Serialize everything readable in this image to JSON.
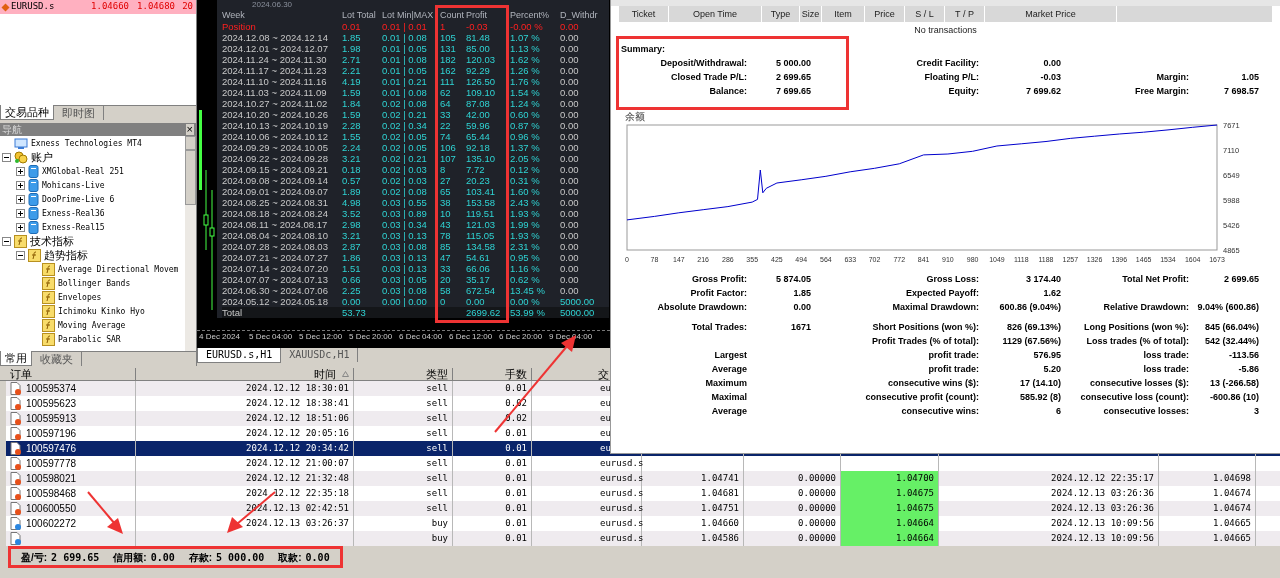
{
  "market_watch": {
    "rows": [
      {
        "symbol": "EURUSD.s",
        "bid": "1.04660",
        "ask": "1.04680",
        "spread": "20"
      }
    ]
  },
  "market_tabs": [
    {
      "label": "交易品种",
      "selected": true
    },
    {
      "label": "即时图",
      "selected": false
    }
  ],
  "navigator": {
    "title": "导航",
    "close": "×",
    "tree": [
      {
        "label": "Exness Technologies MT4",
        "kind": "server"
      },
      {
        "label": "账户",
        "kind": "accounts",
        "expanded": true,
        "children": [
          {
            "label": "XMGlobal-Real 251",
            "kind": "account",
            "expanded": false
          },
          {
            "label": "Mohicans-Live",
            "kind": "account",
            "expanded": false
          },
          {
            "label": "DooPrime-Live 6",
            "kind": "account",
            "expanded": false
          },
          {
            "label": "Exness-Real36",
            "kind": "account",
            "expanded": false
          },
          {
            "label": "Exness-Real15",
            "kind": "account",
            "expanded": false
          }
        ]
      },
      {
        "label": "技术指标",
        "kind": "indicator",
        "expanded": true,
        "children": [
          {
            "label": "趋势指标",
            "kind": "indicator",
            "expanded": true,
            "children": [
              {
                "label": "Average Directional Movem",
                "kind": "indicator"
              },
              {
                "label": "Bollinger Bands",
                "kind": "indicator"
              },
              {
                "label": "Envelopes",
                "kind": "indicator"
              },
              {
                "label": "Ichimoku Kinko Hyo",
                "kind": "indicator"
              },
              {
                "label": "Moving Average",
                "kind": "indicator"
              },
              {
                "label": "Parabolic SAR",
                "kind": "indicator"
              }
            ]
          }
        ]
      }
    ]
  },
  "navigator_tabs": [
    {
      "label": "常用",
      "selected": true
    },
    {
      "label": "收藏夹",
      "selected": false
    }
  ],
  "weekly_report": {
    "caption": "2024.06.30",
    "columns": [
      "Week",
      "Lot Total",
      "Lot Min|MAX",
      "Count",
      "Profit",
      "Percent%",
      "D_Withdr"
    ],
    "rows": [
      {
        "kind": "position",
        "week": "Position",
        "lot_total": "0.01",
        "lot_range": "0.01 | 0.01",
        "count": "1",
        "profit": "-0.03",
        "percent": "-0.00 %",
        "withdrawal": "0.00"
      },
      {
        "kind": "week",
        "week": "2024.12.08 ~ 2024.12.14",
        "lot_total": "1.85",
        "lot_range": "0.01 | 0.08",
        "count": "105",
        "profit": "81.48",
        "percent": "1.07 %",
        "withdrawal": "0.00"
      },
      {
        "kind": "week",
        "week": "2024.12.01 ~ 2024.12.07",
        "lot_total": "1.98",
        "lot_range": "0.01 | 0.05",
        "count": "131",
        "profit": "85.00",
        "percent": "1.13 %",
        "withdrawal": "0.00"
      },
      {
        "kind": "week",
        "week": "2024.11.24 ~ 2024.11.30",
        "lot_total": "2.71",
        "lot_range": "0.01 | 0.08",
        "count": "182",
        "profit": "120.03",
        "percent": "1.62 %",
        "withdrawal": "0.00"
      },
      {
        "kind": "week",
        "week": "2024.11.17 ~ 2024.11.23",
        "lot_total": "2.21",
        "lot_range": "0.01 | 0.05",
        "count": "162",
        "profit": "92.29",
        "percent": "1.26 %",
        "withdrawal": "0.00"
      },
      {
        "kind": "week",
        "week": "2024.11.10 ~ 2024.11.16",
        "lot_total": "4.19",
        "lot_range": "0.01 | 0.21",
        "count": "111",
        "profit": "126.50",
        "percent": "1.76 %",
        "withdrawal": "0.00"
      },
      {
        "kind": "week",
        "week": "2024.11.03 ~ 2024.11.09",
        "lot_total": "1.59",
        "lot_range": "0.01 | 0.08",
        "count": "62",
        "profit": "109.10",
        "percent": "1.54 %",
        "withdrawal": "0.00"
      },
      {
        "kind": "week",
        "week": "2024.10.27 ~ 2024.11.02",
        "lot_total": "1.84",
        "lot_range": "0.02 | 0.08",
        "count": "64",
        "profit": "87.08",
        "percent": "1.24 %",
        "withdrawal": "0.00"
      },
      {
        "kind": "week",
        "week": "2024.10.20 ~ 2024.10.26",
        "lot_total": "1.59",
        "lot_range": "0.02 | 0.21",
        "count": "33",
        "profit": "42.00",
        "percent": "0.60 %",
        "withdrawal": "0.00"
      },
      {
        "kind": "week",
        "week": "2024.10.13 ~ 2024.10.19",
        "lot_total": "2.28",
        "lot_range": "0.02 | 0.34",
        "count": "22",
        "profit": "59.96",
        "percent": "0.87 %",
        "withdrawal": "0.00"
      },
      {
        "kind": "week",
        "week": "2024.10.06 ~ 2024.10.12",
        "lot_total": "1.55",
        "lot_range": "0.02 | 0.05",
        "count": "74",
        "profit": "65.44",
        "percent": "0.96 %",
        "withdrawal": "0.00"
      },
      {
        "kind": "week",
        "week": "2024.09.29 ~ 2024.10.05",
        "lot_total": "2.24",
        "lot_range": "0.02 | 0.05",
        "count": "106",
        "profit": "92.18",
        "percent": "1.37 %",
        "withdrawal": "0.00"
      },
      {
        "kind": "week",
        "week": "2024.09.22 ~ 2024.09.28",
        "lot_total": "3.21",
        "lot_range": "0.02 | 0.21",
        "count": "107",
        "profit": "135.10",
        "percent": "2.05 %",
        "withdrawal": "0.00"
      },
      {
        "kind": "week",
        "week": "2024.09.15 ~ 2024.09.21",
        "lot_total": "0.18",
        "lot_range": "0.02 | 0.03",
        "count": "8",
        "profit": "7.72",
        "percent": "0.12 %",
        "withdrawal": "0.00"
      },
      {
        "kind": "week",
        "week": "2024.09.08 ~ 2024.09.14",
        "lot_total": "0.57",
        "lot_range": "0.02 | 0.03",
        "count": "27",
        "profit": "20.23",
        "percent": "0.31 %",
        "withdrawal": "0.00"
      },
      {
        "kind": "week",
        "week": "2024.09.01 ~ 2024.09.07",
        "lot_total": "1.89",
        "lot_range": "0.02 | 0.08",
        "count": "65",
        "profit": "103.41",
        "percent": "1.60 %",
        "withdrawal": "0.00"
      },
      {
        "kind": "week",
        "week": "2024.08.25 ~ 2024.08.31",
        "lot_total": "4.98",
        "lot_range": "0.03 | 0.55",
        "count": "38",
        "profit": "153.58",
        "percent": "2.43 %",
        "withdrawal": "0.00"
      },
      {
        "kind": "week",
        "week": "2024.08.18 ~ 2024.08.24",
        "lot_total": "3.52",
        "lot_range": "0.03 | 0.89",
        "count": "10",
        "profit": "119.51",
        "percent": "1.93 %",
        "withdrawal": "0.00"
      },
      {
        "kind": "week",
        "week": "2024.08.11 ~ 2024.08.17",
        "lot_total": "2.98",
        "lot_range": "0.03 | 0.34",
        "count": "43",
        "profit": "121.03",
        "percent": "1.99 %",
        "withdrawal": "0.00"
      },
      {
        "kind": "week",
        "week": "2024.08.04 ~ 2024.08.10",
        "lot_total": "3.21",
        "lot_range": "0.03 | 0.13",
        "count": "78",
        "profit": "115.05",
        "percent": "1.93 %",
        "withdrawal": "0.00"
      },
      {
        "kind": "week",
        "week": "2024.07.28 ~ 2024.08.03",
        "lot_total": "2.87",
        "lot_range": "0.03 | 0.08",
        "count": "85",
        "profit": "134.58",
        "percent": "2.31 %",
        "withdrawal": "0.00"
      },
      {
        "kind": "week",
        "week": "2024.07.21 ~ 2024.07.27",
        "lot_total": "1.86",
        "lot_range": "0.03 | 0.13",
        "count": "47",
        "profit": "54.61",
        "percent": "0.95 %",
        "withdrawal": "0.00"
      },
      {
        "kind": "week",
        "week": "2024.07.14 ~ 2024.07.20",
        "lot_total": "1.51",
        "lot_range": "0.03 | 0.13",
        "count": "33",
        "profit": "66.06",
        "percent": "1.16 %",
        "withdrawal": "0.00"
      },
      {
        "kind": "week",
        "week": "2024.07.07 ~ 2024.07.13",
        "lot_total": "0.66",
        "lot_range": "0.03 | 0.05",
        "count": "20",
        "profit": "35.17",
        "percent": "0.62 %",
        "withdrawal": "0.00"
      },
      {
        "kind": "week",
        "week": "2024.06.30 ~ 2024.07.06",
        "lot_total": "2.25",
        "lot_range": "0.03 | 0.08",
        "count": "58",
        "profit": "672.54",
        "percent": "13.45 %",
        "withdrawal": "0.00"
      },
      {
        "kind": "deposit",
        "week": "2024.05.12 ~ 2024.05.18",
        "lot_total": "0.00",
        "lot_range": "0.00 | 0.00",
        "count": "0",
        "profit": "0.00",
        "percent": "0.00 %",
        "withdrawal": "5000.00"
      },
      {
        "kind": "total",
        "week": "Total",
        "lot_total": "53.73",
        "profit": "2699.62",
        "percent": "53.99 %",
        "withdrawal": "5000.00"
      }
    ]
  },
  "chart_axis": [
    "4 Dec 2024",
    "5 Dec 04:00",
    "5 Dec 12:00",
    "5 Dec 20:00",
    "6 Dec 04:00",
    "6 Dec 12:00",
    "6 Dec 20:00",
    "9 Dec 04:00"
  ],
  "chart_tabs": [
    {
      "label": "EURUSD.s,H1",
      "selected": true
    },
    {
      "label": "XAUUSDc,H1",
      "selected": false
    }
  ],
  "report": {
    "orders_columns": [
      "Ticket",
      "Open Time",
      "Type",
      "Size",
      "Item",
      "Price",
      "S / L",
      "T / P",
      "Market Price"
    ],
    "empty_message": "No transactions",
    "summary_title": "Summary:",
    "summary_rows": [
      {
        "label_1": "Deposit/Withdrawal:",
        "value_1": "5 000.00",
        "label_2": "Credit Facility:",
        "value_2": "0.00"
      },
      {
        "label_1": "Closed Trade P/L:",
        "value_1": "2 699.65",
        "label_2": "Floating P/L:",
        "value_2": "-0.03",
        "label_3": "Margin:",
        "value_3": "1.05"
      },
      {
        "label_1": "Balance:",
        "value_1": "7 699.65",
        "label_2": "Equity:",
        "value_2": "7 699.62",
        "label_3": "Free Margin:",
        "value_3": "7 698.57"
      }
    ],
    "chart": {
      "chart_data": {
        "type": "line",
        "title": "余额",
        "x": [
          0,
          78,
          147,
          216,
          286,
          355,
          370,
          378,
          385,
          395,
          425,
          494,
          564,
          633,
          702,
          772,
          841,
          910,
          980,
          1049,
          1118,
          1188,
          1257,
          1326,
          1396,
          1465,
          1534,
          1604,
          1673
        ],
        "series": [
          {
            "color": "#0000cc",
            "values": [
              5540,
              5620,
              5700,
              5770,
              5840,
              5940,
              6000,
              6660,
              6150,
              6250,
              6370,
              6440,
              6520,
              6620,
              6700,
              6800,
              7000,
              7020,
              7080,
              7200,
              7250,
              7300,
              7370,
              7420,
              7470,
              7510,
              7560,
              7620,
              7670
            ]
          }
        ],
        "xlim": [
          0,
          1673
        ],
        "ylim": [
          4865,
          7671
        ],
        "xticks": [
          0,
          78,
          147,
          216,
          286,
          355,
          425,
          494,
          564,
          633,
          702,
          772,
          841,
          910,
          980,
          1049,
          1118,
          1188,
          1257,
          1326,
          1396,
          1465,
          1534,
          1604,
          1673
        ],
        "yticks": [
          4865,
          5426,
          5988,
          6549,
          7110,
          7671
        ]
      }
    },
    "stats": [
      [
        {
          "label_1": "Gross Profit:",
          "value_1": "5 874.05",
          "label_2": "Gross Loss:",
          "value_2": "3 174.40",
          "label_3": "Total Net Profit:",
          "value_3": "2 699.65"
        },
        {
          "label_1": "Profit Factor:",
          "value_1": "1.85",
          "label_2": "Expected Payoff:",
          "value_2": "1.62"
        },
        {
          "label_1": "Absolute Drawdown:",
          "value_1": "0.00",
          "label_2": "Maximal Drawdown:",
          "value_2": "600.86 (9.04%)",
          "label_3": "Relative Drawdown:",
          "value_3": "9.04% (600.86)"
        }
      ],
      [
        {
          "label_1": "Total Trades:",
          "value_1": "1671",
          "label_2": "Short Positions (won %):",
          "value_2": "826 (69.13%)",
          "label_3": "Long Positions (won %):",
          "value_3": "845 (66.04%)"
        },
        {
          "label_2": "Profit Trades (% of total):",
          "value_2": "1129 (67.56%)",
          "label_3": "Loss trades (% of total):",
          "value_3": "542 (32.44%)"
        },
        {
          "label_1": "Largest",
          "label_2": "profit trade:",
          "value_2": "576.95",
          "label_3": "loss trade:",
          "value_3": "-113.56"
        },
        {
          "label_1": "Average",
          "label_2": "profit trade:",
          "value_2": "5.20",
          "label_3": "loss trade:",
          "value_3": "-5.86"
        },
        {
          "label_1": "Maximum",
          "label_2": "consecutive wins ($):",
          "value_2": "17 (14.10)",
          "label_3": "consecutive losses ($):",
          "value_3": "13 (-266.58)"
        },
        {
          "label_1": "Maximal",
          "label_2": "consecutive profit (count):",
          "value_2": "585.92 (8)",
          "label_3": "consecutive loss (count):",
          "value_3": "-600.86 (10)"
        },
        {
          "label_1": "Average",
          "label_2": "consecutive wins:",
          "value_2": "6",
          "label_3": "consecutive losses:",
          "value_3": "3"
        }
      ]
    ]
  },
  "terminal": {
    "columns": [
      "订单",
      "时间",
      "类型",
      "手数",
      "交"
    ],
    "rows": [
      {
        "kind": "sell",
        "selected": false,
        "order": "100595374",
        "time": "2024.12.12 18:30:01",
        "type": "sell",
        "lots": "0.01",
        "symbol": "eu"
      },
      {
        "kind": "sell",
        "selected": false,
        "order": "100595623",
        "time": "2024.12.12 18:38:41",
        "type": "sell",
        "lots": "0.02",
        "symbol": "eu"
      },
      {
        "kind": "sell",
        "selected": false,
        "order": "100595913",
        "time": "2024.12.12 18:51:06",
        "type": "sell",
        "lots": "0.02",
        "symbol": "eu"
      },
      {
        "kind": "sell",
        "selected": false,
        "order": "100597196",
        "time": "2024.12.12 20:05:16",
        "type": "sell",
        "lots": "0.01",
        "symbol": "eu"
      },
      {
        "kind": "sell",
        "selected": true,
        "order": "100597476",
        "time": "2024.12.12 20:34:42",
        "type": "sell",
        "lots": "0.01",
        "symbol": "eu"
      },
      {
        "kind": "sell",
        "selected": false,
        "order": "100597778",
        "time": "2024.12.12 21:00:07",
        "type": "sell",
        "lots": "0.01",
        "symbol": "eurusd.s"
      },
      {
        "kind": "sell",
        "selected": false,
        "order": "100598021",
        "time": "2024.12.12 21:32:48",
        "type": "sell",
        "lots": "0.01",
        "symbol": "eurusd.s",
        "open_price": "1.04741",
        "sl": "0.00000",
        "tp": "1.04700",
        "close_time": "2024.12.12 22:35:17",
        "close_price": "1.04698"
      },
      {
        "kind": "sell",
        "selected": false,
        "order": "100598468",
        "time": "2024.12.12 22:35:18",
        "type": "sell",
        "lots": "0.01",
        "symbol": "eurusd.s",
        "open_price": "1.04681",
        "sl": "0.00000",
        "tp": "1.04675",
        "close_time": "2024.12.13 03:26:36",
        "close_price": "1.04674"
      },
      {
        "kind": "sell",
        "selected": false,
        "order": "100600550",
        "time": "2024.12.13 02:42:51",
        "type": "sell",
        "lots": "0.01",
        "symbol": "eurusd.s",
        "open_price": "1.04751",
        "sl": "0.00000",
        "tp": "1.04675",
        "close_time": "2024.12.13 03:26:36",
        "close_price": "1.04674"
      },
      {
        "kind": "buy",
        "selected": false,
        "order": "100602272",
        "time": "2024.12.13 03:26:37",
        "type": "buy",
        "lots": "0.01",
        "symbol": "eurusd.s",
        "open_price": "1.04660",
        "sl": "0.00000",
        "tp": "1.04664",
        "close_time": "2024.12.13 10:09:56",
        "close_price": "1.04665"
      },
      {
        "kind": "buy",
        "selected": false,
        "type": "buy",
        "lots": "0.01",
        "symbol": "eurusd.s",
        "open_price": "1.04586",
        "sl": "0.00000",
        "tp": "1.04664",
        "close_time": "2024.12.13 10:09:56",
        "close_price": "1.04665"
      }
    ]
  },
  "status_bar": [
    {
      "label": "盈/亏:",
      "value": "2 699.65"
    },
    {
      "label": "信用额:",
      "value": "0.00"
    },
    {
      "label": "存款:",
      "value": "5 000.00"
    },
    {
      "label": "取款:",
      "value": "0.00"
    }
  ]
}
